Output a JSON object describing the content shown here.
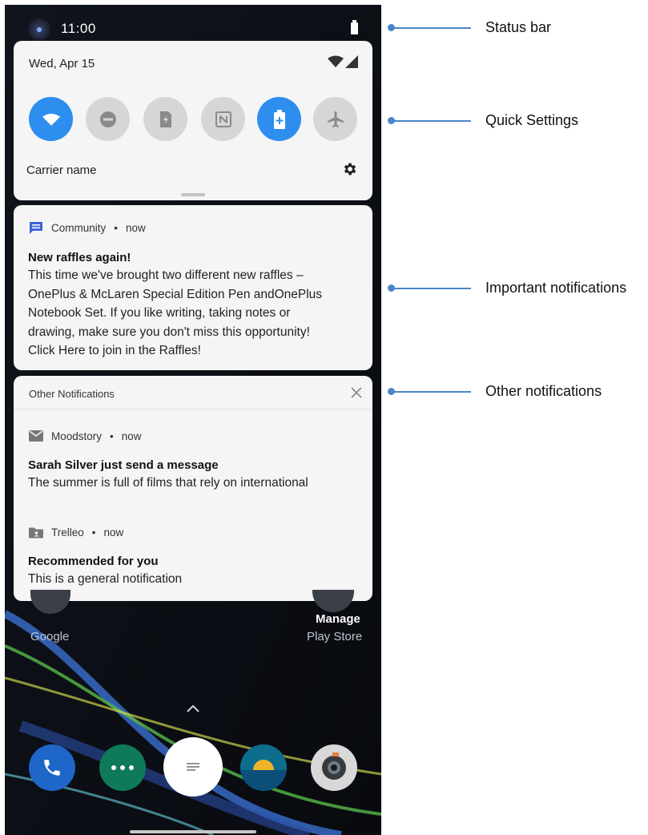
{
  "status_bar": {
    "time": "11:00"
  },
  "quick_settings": {
    "date": "Wed, Apr 15",
    "carrier": "Carrier name",
    "tiles": [
      {
        "name": "wifi-icon",
        "on": true
      },
      {
        "name": "do-not-disturb-icon",
        "on": false
      },
      {
        "name": "auto-rotate-icon",
        "on": false
      },
      {
        "name": "nfc-icon",
        "on": false
      },
      {
        "name": "battery-saver-icon",
        "on": true
      },
      {
        "name": "airplane-mode-icon",
        "on": false
      }
    ],
    "accent_color": "#2d8ef0"
  },
  "important_notification": {
    "app": "Community",
    "time": "now",
    "title": "New raffles again!",
    "body_lines": [
      "This time we've brought two different new raffles –",
      "OnePlus & McLaren Special Edition Pen andOnePlus",
      "Notebook Set. If you like writing, taking notes or",
      "drawing, make sure you don't miss this opportunity!",
      "Click Here to join in the Raffles!"
    ]
  },
  "other_notifications": {
    "header": "Other Notifications",
    "items": [
      {
        "app": "Moodstory",
        "time": "now",
        "title": "Sarah Silver just send a message",
        "body": "The summer is full of films that rely on international"
      },
      {
        "app": "Trelleo",
        "time": "now",
        "title": "Recommended for you",
        "body": "This is a general notification"
      }
    ]
  },
  "home": {
    "google_label": "Google",
    "manage_label": "Manage",
    "play_store_label": "Play Store"
  },
  "annotations": {
    "status_bar": "Status bar",
    "quick_settings": "Quick Settings",
    "important": "Important notifications",
    "other": "Other notifications"
  },
  "sep": "•"
}
